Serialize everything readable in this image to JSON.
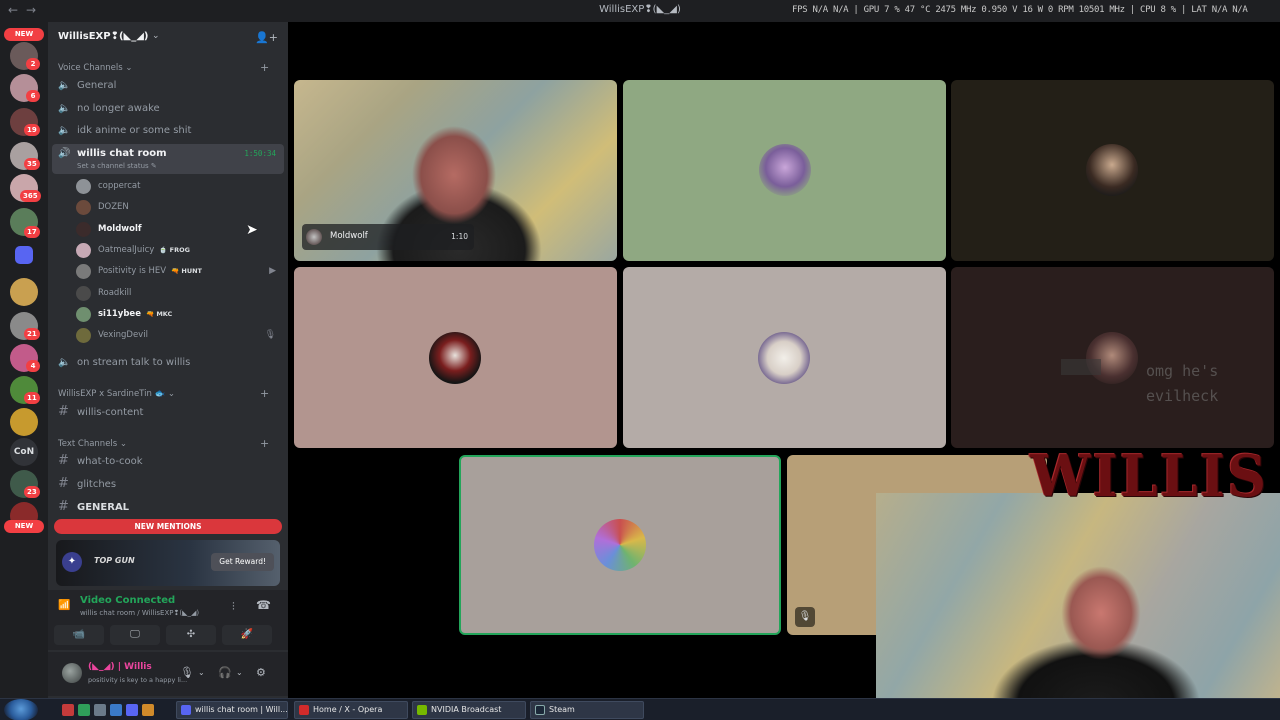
{
  "titlebar": {
    "back": "←",
    "forward": "→",
    "title": "WillisEXP❢(◣_◢)",
    "stats": "FPS  N/A  N/A  |  GPU  7 %  47 °C  2475 MHz  0.950 V  16 W  0 RPM  10501 MHz  |  CPU  8 %  |  LAT  N/A  N/A"
  },
  "rail": {
    "new_top": "NEW",
    "badges": [
      "2",
      "6",
      "19",
      "35",
      "365",
      "17",
      "21",
      "4",
      "11",
      "23"
    ],
    "con_label": "CoN",
    "new_bottom": "NEW"
  },
  "server": {
    "name": "WillisEXP❢(◣_◢)",
    "chevron": "⌄",
    "invite_icon": "👤+"
  },
  "categories": {
    "voice": "Voice Channels ⌄",
    "collab": "WillisEXP x SardineTin 🐟 ⌄",
    "text": "Text Channels ⌄",
    "plus": "+"
  },
  "voice_channels": [
    {
      "name": "General"
    },
    {
      "name": "no longer awake"
    },
    {
      "name": "idk anime or some shit"
    }
  ],
  "active_channel": {
    "name": "willis chat room",
    "timer": "1:50:34",
    "status": "Set a channel status ✎"
  },
  "members": [
    {
      "name": "coppercat",
      "tag": "",
      "bright": false,
      "color": "#8e9297"
    },
    {
      "name": "DOZEN",
      "tag": "",
      "bright": false,
      "color": "#6b4a3c"
    },
    {
      "name": "Moldwolf",
      "tag": "",
      "bright": true,
      "color": "#3b2b2b"
    },
    {
      "name": "OatmealJuicy",
      "tag": "🍵 FROG",
      "bright": false,
      "color": "#c7a9b5"
    },
    {
      "name": "Positivity is HEV",
      "tag": "🔫 HUNT",
      "bright": false,
      "color": "#7a7a7a"
    },
    {
      "name": "Roadkill",
      "tag": "",
      "bright": false,
      "color": "#4a4a4a"
    },
    {
      "name": "si11ybee",
      "tag": "🔫 MKC",
      "bright": true,
      "color": "#6f8f6f"
    },
    {
      "name": "VexingDevil",
      "tag": "",
      "bright": false,
      "color": "#6e6a3c"
    }
  ],
  "member_icons": {
    "video": "▶",
    "muted": "🎙"
  },
  "stream_channel": {
    "name": "on stream talk to willis"
  },
  "collab_channel": {
    "name": "willis-content"
  },
  "text_channels": [
    {
      "name": "what-to-cook"
    },
    {
      "name": "glitches"
    },
    {
      "name": "GENERAL"
    }
  ],
  "new_mentions": "NEW MENTIONS",
  "promo": {
    "brand": "TOP GUN",
    "button": "Get Reward!"
  },
  "voice_panel": {
    "status": "Video Connected",
    "sub": "willis chat room / WillisEXP❢(◣_◢)",
    "buttons": [
      "📹",
      "🖵",
      "✣",
      "🚀"
    ]
  },
  "user_panel": {
    "name": "(◣_◢) | Willis",
    "status": "positivity is key to a happy li..."
  },
  "tiles": {
    "tile1_name": "Moldwolf",
    "tile1_time": "1:10",
    "overlay_text": "omg he's evilheck",
    "tile8_muted": "🎙"
  },
  "overlay_logo": "WILLIS",
  "taskbar": {
    "items": [
      {
        "label": "willis chat room | Will...",
        "color": "#5865f2"
      },
      {
        "label": "Home / X - Opera",
        "color": "#d12b2b"
      },
      {
        "label": "NVIDIA Broadcast",
        "color": "#76b900"
      },
      {
        "label": "Steam",
        "color": "#1b2838"
      }
    ]
  }
}
